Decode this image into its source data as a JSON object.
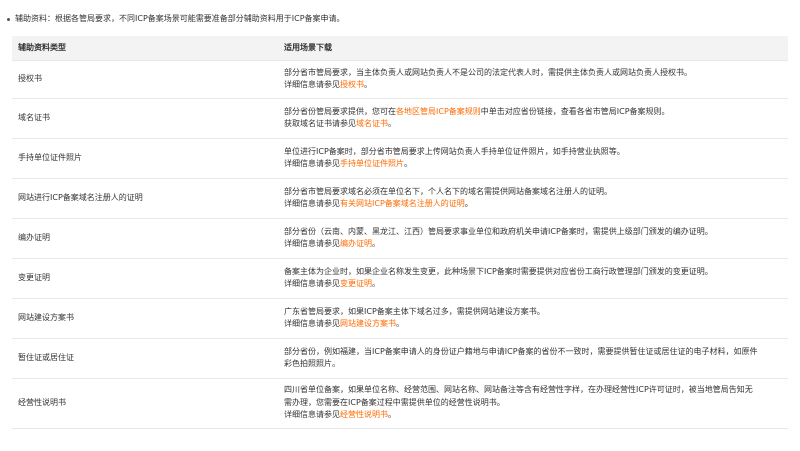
{
  "intro": "辅助资料：根据各管局要求，不同ICP备案场景可能需要准备部分辅助资料用于ICP备案申请。",
  "table": {
    "headers": [
      "辅助资料类型",
      "适用场景下载"
    ],
    "rows": [
      {
        "type": "授权书",
        "lines": [
          [
            {
              "text": "部分省市管局要求，当主体负责人或网站负责人不是公司的法定代表人时，需提供主体负责人或网站负责人授权书。"
            }
          ],
          [
            {
              "text": "详细信息请参见"
            },
            {
              "text": "授权书",
              "link": true
            },
            {
              "text": "。"
            }
          ]
        ]
      },
      {
        "type": "域名证书",
        "lines": [
          [
            {
              "text": "部分省份管局要求提供，您可在"
            },
            {
              "text": "各地区管局ICP备案规则",
              "link": true
            },
            {
              "text": "中单击对应省份链接，查看各省市管局ICP备案规则。"
            }
          ],
          [
            {
              "text": "获取域名证书请参见"
            },
            {
              "text": "域名证书",
              "link": true
            },
            {
              "text": "。"
            }
          ]
        ]
      },
      {
        "type": "手持单位证件照片",
        "lines": [
          [
            {
              "text": "单位进行ICP备案时，部分省市管局要求上传网站负责人手持单位证件照片，如手持营业执照等。"
            }
          ],
          [
            {
              "text": "详细信息请参见"
            },
            {
              "text": "手持单位证件照片",
              "link": true
            },
            {
              "text": "。"
            }
          ]
        ]
      },
      {
        "type": "网站进行ICP备案域名注册人的证明",
        "lines": [
          [
            {
              "text": "部分省市管局要求域名必须在单位名下，个人名下的域名需提供网站备案域名注册人的证明。"
            }
          ],
          [
            {
              "text": "详细信息请参见"
            },
            {
              "text": "有关网站ICP备案域名注册人的证明",
              "link": true
            },
            {
              "text": "。"
            }
          ]
        ]
      },
      {
        "type": "编办证明",
        "lines": [
          [
            {
              "text": "部分省份（云南、内蒙、黑龙江、江西）管局要求事业单位和政府机关申请ICP备案时，需提供上级部门颁发的编办证明。"
            }
          ],
          [
            {
              "text": "详细信息请参见"
            },
            {
              "text": "编办证明",
              "link": true
            },
            {
              "text": "。"
            }
          ]
        ]
      },
      {
        "type": "变更证明",
        "lines": [
          [
            {
              "text": "备案主体为企业时，如果企业名称发生变更，此种场景下ICP备案时需要提供对应省份工商行政管理部门颁发的变更证明。"
            }
          ],
          [
            {
              "text": "详细信息请参见"
            },
            {
              "text": "变更证明",
              "link": true
            },
            {
              "text": "。"
            }
          ]
        ]
      },
      {
        "type": "网站建设方案书",
        "lines": [
          [
            {
              "text": "广东省管局要求，如果ICP备案主体下域名过多，需提供网站建设方案书。"
            }
          ],
          [
            {
              "text": "详细信息请参见"
            },
            {
              "text": "网站建设方案书",
              "link": true
            },
            {
              "text": "。"
            }
          ]
        ]
      },
      {
        "type": "暂住证或居住证",
        "lines": [
          [
            {
              "text": "部分省份，例如福建，当ICP备案申请人的身份证户籍地与申请ICP备案的省份不一致时，需要提供暂住证或居住证的电子材料，如原件"
            }
          ],
          [
            {
              "text": "彩色拍照照片。"
            }
          ]
        ]
      },
      {
        "type": "经营性说明书",
        "lines": [
          [
            {
              "text": "四川省单位备案，如果单位名称、经营范围、网站名称、网站备注等含有经营性字样，在办理经营性ICP许可证时，被当地管局告知无"
            }
          ],
          [
            {
              "text": "需办理，您需要在ICP备案过程中需提供单位的经营性说明书。"
            }
          ],
          [
            {
              "text": "详细信息请参见"
            },
            {
              "text": "经营性说明书",
              "link": true
            },
            {
              "text": "。"
            }
          ]
        ]
      }
    ]
  }
}
